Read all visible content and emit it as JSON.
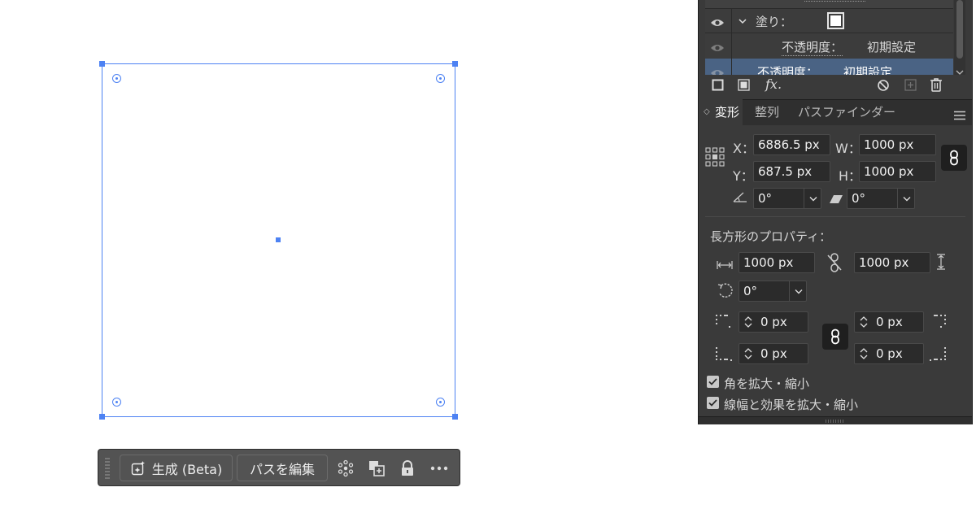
{
  "taskbar": {
    "generate_label": "生成 (Beta)",
    "edit_path_label": "パスを編集"
  },
  "appearance": {
    "fill_label": "塗り：",
    "opacity_row_1_label": "不透明度：",
    "opacity_row_1_value": "初期設定",
    "opacity_row_2_label": "不透明度：",
    "opacity_row_2_value": "初期設定",
    "fx_label": "fx."
  },
  "tabs": {
    "transform": "変形",
    "align": "整列",
    "pathfinder": "パスファインダー"
  },
  "transform": {
    "x_label": "X：",
    "x_value": "6886.5 px",
    "y_label": "Y：",
    "y_value": "687.5 px",
    "w_label": "W：",
    "w_value": "1000 px",
    "h_label": "H：",
    "h_value": "1000 px",
    "rotate_value": "0°",
    "shear_value": "0°"
  },
  "rect_props": {
    "title": "長方形のプロパティ：",
    "width_value": "1000 px",
    "height_value": "1000 px",
    "rotation_value": "0°",
    "corner_tl": "0 px",
    "corner_tr": "0 px",
    "corner_bl": "0 px",
    "corner_br": "0 px"
  },
  "options": {
    "scale_corners_label": "角を拡大・縮小",
    "scale_corners_checked": true,
    "scale_strokes_label": "線幅と効果を拡大・縮小",
    "scale_strokes_checked": true
  },
  "colors": {
    "selection": "#4d82f3",
    "panel_bg": "#3a3a3a",
    "field_bg": "#2b2b2b",
    "highlight_row": "#4a6384"
  }
}
